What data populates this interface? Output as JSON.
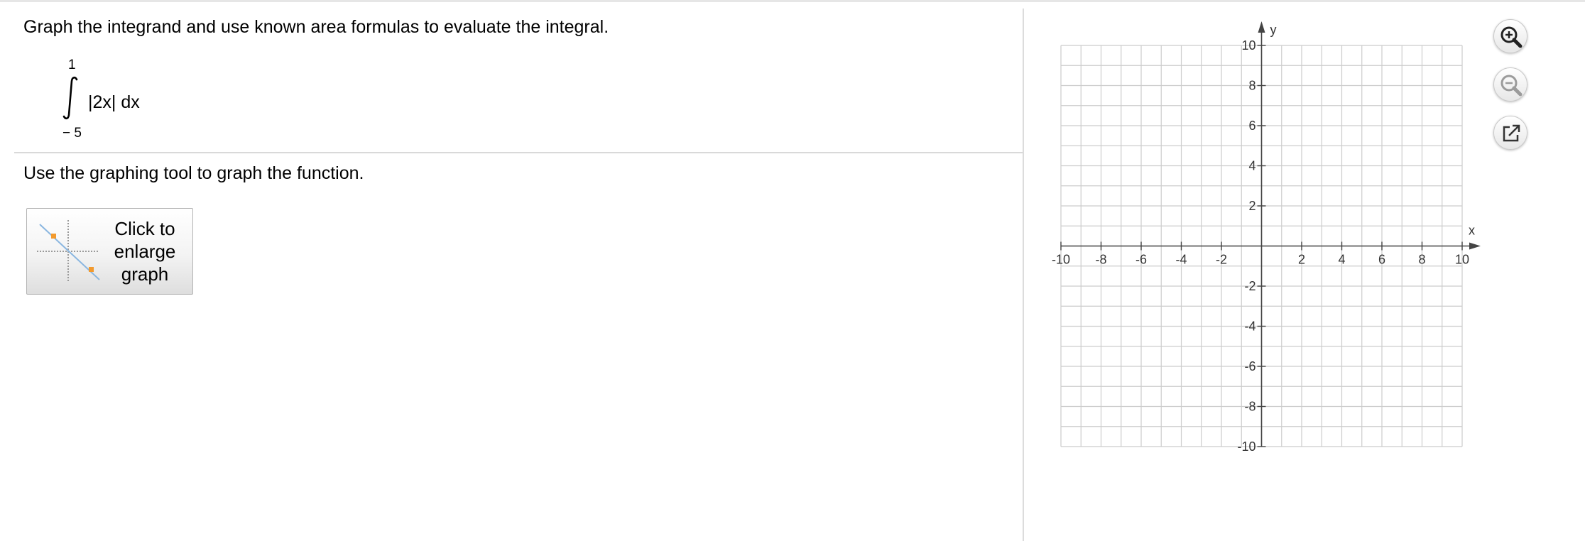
{
  "question": {
    "instruction": "Graph the integrand and use known area formulas to evaluate the integral.",
    "integral": {
      "upper_limit": "1",
      "lower_limit": "− 5",
      "integrand": "|2x| dx"
    },
    "graph_instruction": "Use the graphing tool to graph the function.",
    "enlarge_button": {
      "label_lines": [
        "Click to",
        "enlarge",
        "graph"
      ]
    }
  },
  "graph": {
    "x_axis_label": "x",
    "y_axis_label": "y",
    "xlim": [
      -10,
      10
    ],
    "ylim": [
      -10,
      10
    ],
    "minor_step": 1,
    "label_step": 2,
    "x_tick_labels": [
      "-10",
      "-8",
      "-6",
      "-4",
      "-2",
      "2",
      "4",
      "6",
      "8",
      "10"
    ],
    "y_tick_labels": [
      "10",
      "8",
      "6",
      "4",
      "2",
      "-2",
      "-4",
      "-6",
      "-8",
      "-10"
    ],
    "grid_color": "#cccccc",
    "axis_color": "#444444"
  },
  "toolbar": {
    "zoom_in": {
      "icon": "zoom-in-icon"
    },
    "zoom_out": {
      "icon": "zoom-out-icon"
    },
    "popout": {
      "icon": "popout-icon"
    }
  },
  "colors": {
    "line": "#7aaed9",
    "point": "#f29a2e"
  }
}
